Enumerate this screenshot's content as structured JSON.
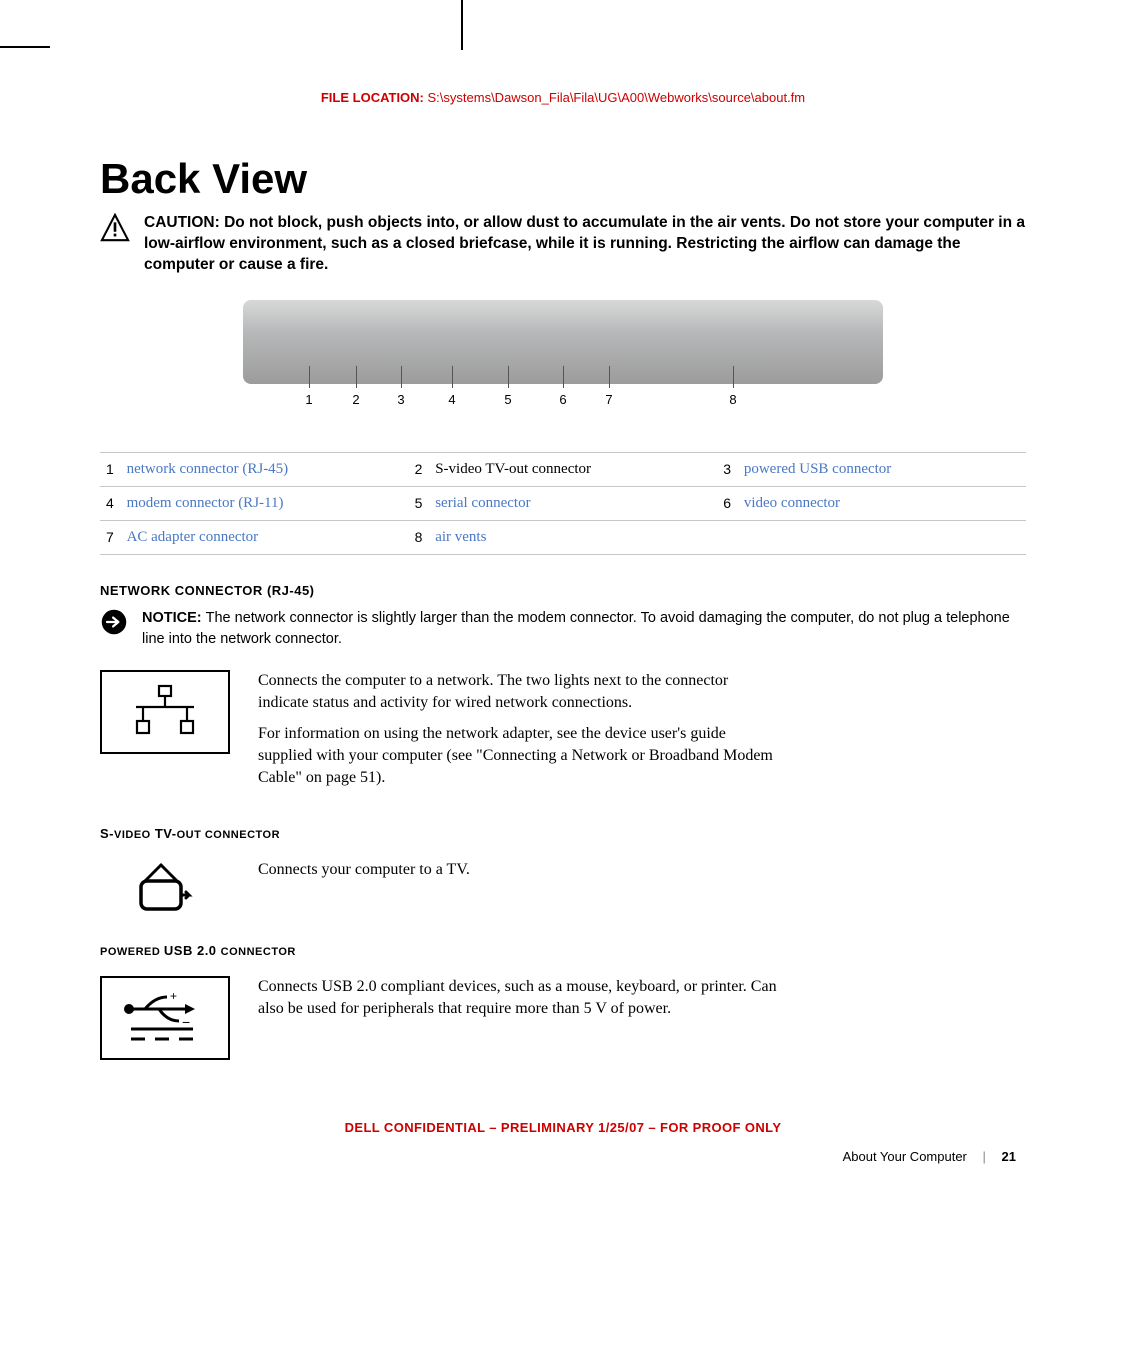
{
  "file_location": {
    "label": "FILE LOCATION:  ",
    "path": "S:\\systems\\Dawson_Fila\\Fila\\UG\\A00\\Webworks\\source\\about.fm"
  },
  "title": "Back View",
  "caution": {
    "label": "CAUTION: ",
    "text": "Do not block, push objects into, or allow dust to accumulate in the air vents. Do not store your computer in a low-airflow environment, such as a closed briefcase, while it is running. Restricting the airflow can damage the computer or cause a fire."
  },
  "callout_nums": [
    "1",
    "2",
    "3",
    "4",
    "5",
    "6",
    "7",
    "8"
  ],
  "legend": [
    [
      {
        "n": "1",
        "t": "network connector (RJ-45)",
        "link": true
      },
      {
        "n": "2",
        "t": "S-video TV-out connector",
        "link": false
      },
      {
        "n": "3",
        "t": "powered USB connector",
        "link": true
      }
    ],
    [
      {
        "n": "4",
        "t": "modem connector (RJ-11)",
        "link": true
      },
      {
        "n": "5",
        "t": "serial connector",
        "link": true
      },
      {
        "n": "6",
        "t": "video connector",
        "link": true
      }
    ],
    [
      {
        "n": "7",
        "t": "AC adapter connector",
        "link": true
      },
      {
        "n": "8",
        "t": "air vents",
        "link": true
      },
      {
        "n": "",
        "t": "",
        "link": false
      }
    ]
  ],
  "sections": {
    "network": {
      "heading_pre": "NETWORK CONNECTOR ",
      "heading_paren": "(RJ-45)",
      "notice_label": "NOTICE: ",
      "notice_text": "The network connector is slightly larger than the modem connector. To avoid damaging the computer, do not plug a telephone line into the network connector.",
      "p1": "Connects the computer to a network. The two lights next to the connector indicate status and activity for wired network connections.",
      "p2": "For information on using the network adapter, see the device user's guide supplied with your computer (see \"Connecting a Network or Broadband Modem Cable\" on page 51)."
    },
    "svideo": {
      "heading_pre": "S-",
      "heading_mid": "VIDEO",
      "heading_post": " TV-",
      "heading_mid2": "OUT CONNECTOR",
      "p1": "Connects your computer to a TV."
    },
    "usb": {
      "heading_pre": "POWERED ",
      "heading_mid": "USB 2.0 ",
      "heading_post": "CONNECTOR",
      "p1": "Connects USB 2.0 compliant devices, such as a mouse, keyboard, or printer. Can also be used for peripherals that require more than 5 V of power."
    }
  },
  "confidential": "DELL CONFIDENTIAL – PRELIMINARY 1/25/07 – FOR PROOF ONLY",
  "footer": {
    "section": "About Your Computer",
    "page": "21"
  }
}
